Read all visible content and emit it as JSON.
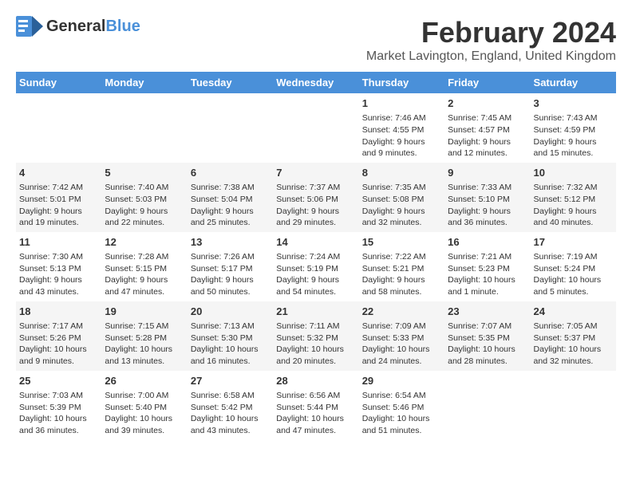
{
  "logo": {
    "general": "General",
    "blue": "Blue"
  },
  "title": {
    "month": "February 2024",
    "location": "Market Lavington, England, United Kingdom"
  },
  "weekdays": [
    "Sunday",
    "Monday",
    "Tuesday",
    "Wednesday",
    "Thursday",
    "Friday",
    "Saturday"
  ],
  "weeks": [
    [
      {
        "day": "",
        "info": ""
      },
      {
        "day": "",
        "info": ""
      },
      {
        "day": "",
        "info": ""
      },
      {
        "day": "",
        "info": ""
      },
      {
        "day": "1",
        "info": "Sunrise: 7:46 AM\nSunset: 4:55 PM\nDaylight: 9 hours\nand 9 minutes."
      },
      {
        "day": "2",
        "info": "Sunrise: 7:45 AM\nSunset: 4:57 PM\nDaylight: 9 hours\nand 12 minutes."
      },
      {
        "day": "3",
        "info": "Sunrise: 7:43 AM\nSunset: 4:59 PM\nDaylight: 9 hours\nand 15 minutes."
      }
    ],
    [
      {
        "day": "4",
        "info": "Sunrise: 7:42 AM\nSunset: 5:01 PM\nDaylight: 9 hours\nand 19 minutes."
      },
      {
        "day": "5",
        "info": "Sunrise: 7:40 AM\nSunset: 5:03 PM\nDaylight: 9 hours\nand 22 minutes."
      },
      {
        "day": "6",
        "info": "Sunrise: 7:38 AM\nSunset: 5:04 PM\nDaylight: 9 hours\nand 25 minutes."
      },
      {
        "day": "7",
        "info": "Sunrise: 7:37 AM\nSunset: 5:06 PM\nDaylight: 9 hours\nand 29 minutes."
      },
      {
        "day": "8",
        "info": "Sunrise: 7:35 AM\nSunset: 5:08 PM\nDaylight: 9 hours\nand 32 minutes."
      },
      {
        "day": "9",
        "info": "Sunrise: 7:33 AM\nSunset: 5:10 PM\nDaylight: 9 hours\nand 36 minutes."
      },
      {
        "day": "10",
        "info": "Sunrise: 7:32 AM\nSunset: 5:12 PM\nDaylight: 9 hours\nand 40 minutes."
      }
    ],
    [
      {
        "day": "11",
        "info": "Sunrise: 7:30 AM\nSunset: 5:13 PM\nDaylight: 9 hours\nand 43 minutes."
      },
      {
        "day": "12",
        "info": "Sunrise: 7:28 AM\nSunset: 5:15 PM\nDaylight: 9 hours\nand 47 minutes."
      },
      {
        "day": "13",
        "info": "Sunrise: 7:26 AM\nSunset: 5:17 PM\nDaylight: 9 hours\nand 50 minutes."
      },
      {
        "day": "14",
        "info": "Sunrise: 7:24 AM\nSunset: 5:19 PM\nDaylight: 9 hours\nand 54 minutes."
      },
      {
        "day": "15",
        "info": "Sunrise: 7:22 AM\nSunset: 5:21 PM\nDaylight: 9 hours\nand 58 minutes."
      },
      {
        "day": "16",
        "info": "Sunrise: 7:21 AM\nSunset: 5:23 PM\nDaylight: 10 hours\nand 1 minute."
      },
      {
        "day": "17",
        "info": "Sunrise: 7:19 AM\nSunset: 5:24 PM\nDaylight: 10 hours\nand 5 minutes."
      }
    ],
    [
      {
        "day": "18",
        "info": "Sunrise: 7:17 AM\nSunset: 5:26 PM\nDaylight: 10 hours\nand 9 minutes."
      },
      {
        "day": "19",
        "info": "Sunrise: 7:15 AM\nSunset: 5:28 PM\nDaylight: 10 hours\nand 13 minutes."
      },
      {
        "day": "20",
        "info": "Sunrise: 7:13 AM\nSunset: 5:30 PM\nDaylight: 10 hours\nand 16 minutes."
      },
      {
        "day": "21",
        "info": "Sunrise: 7:11 AM\nSunset: 5:32 PM\nDaylight: 10 hours\nand 20 minutes."
      },
      {
        "day": "22",
        "info": "Sunrise: 7:09 AM\nSunset: 5:33 PM\nDaylight: 10 hours\nand 24 minutes."
      },
      {
        "day": "23",
        "info": "Sunrise: 7:07 AM\nSunset: 5:35 PM\nDaylight: 10 hours\nand 28 minutes."
      },
      {
        "day": "24",
        "info": "Sunrise: 7:05 AM\nSunset: 5:37 PM\nDaylight: 10 hours\nand 32 minutes."
      }
    ],
    [
      {
        "day": "25",
        "info": "Sunrise: 7:03 AM\nSunset: 5:39 PM\nDaylight: 10 hours\nand 36 minutes."
      },
      {
        "day": "26",
        "info": "Sunrise: 7:00 AM\nSunset: 5:40 PM\nDaylight: 10 hours\nand 39 minutes."
      },
      {
        "day": "27",
        "info": "Sunrise: 6:58 AM\nSunset: 5:42 PM\nDaylight: 10 hours\nand 43 minutes."
      },
      {
        "day": "28",
        "info": "Sunrise: 6:56 AM\nSunset: 5:44 PM\nDaylight: 10 hours\nand 47 minutes."
      },
      {
        "day": "29",
        "info": "Sunrise: 6:54 AM\nSunset: 5:46 PM\nDaylight: 10 hours\nand 51 minutes."
      },
      {
        "day": "",
        "info": ""
      },
      {
        "day": "",
        "info": ""
      }
    ]
  ]
}
